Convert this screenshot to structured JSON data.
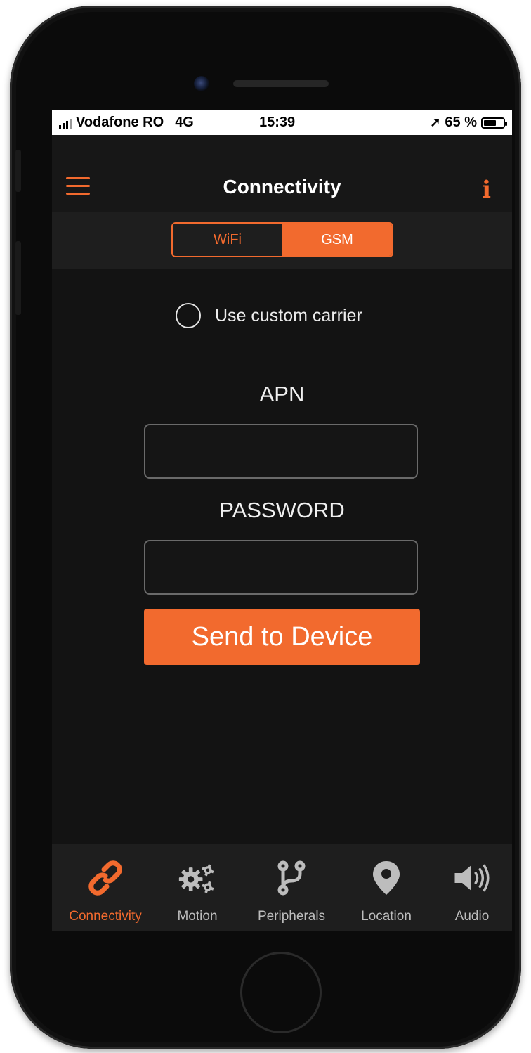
{
  "status_bar": {
    "carrier": "Vodafone RO",
    "network": "4G",
    "time": "15:39",
    "battery": "65 %",
    "battery_level": 0.65
  },
  "header": {
    "title": "Connectivity"
  },
  "segmented": {
    "options": [
      "WiFi",
      "GSM"
    ],
    "selected": "GSM"
  },
  "form": {
    "custom_carrier_label": "Use custom carrier",
    "custom_carrier_checked": false,
    "apn_label": "APN",
    "apn_value": "",
    "password_label": "PASSWORD",
    "password_value": "",
    "send_button": "Send to Device"
  },
  "tab_bar": {
    "items": [
      {
        "label": "Connectivity",
        "icon": "link-icon",
        "active": true
      },
      {
        "label": "Motion",
        "icon": "gears-icon",
        "active": false
      },
      {
        "label": "Peripherals",
        "icon": "branch-icon",
        "active": false
      },
      {
        "label": "Location",
        "icon": "map-pin-icon",
        "active": false
      },
      {
        "label": "Audio",
        "icon": "speaker-icon",
        "active": false
      }
    ]
  },
  "colors": {
    "accent": "#f26a2e",
    "background": "#131313",
    "tab_inactive": "#bdbdbd"
  }
}
